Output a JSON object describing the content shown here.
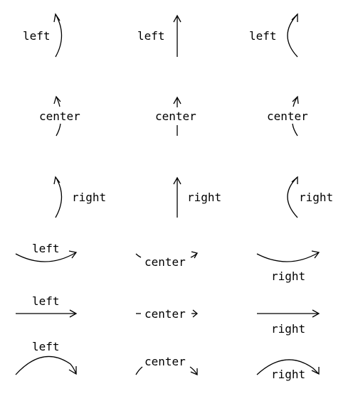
{
  "ink_color": "#000000",
  "background": "#ffffff",
  "labels": {
    "left": "left",
    "center": "center",
    "right": "right"
  },
  "examples": [
    {
      "group": "vertical",
      "label_key": "left",
      "shape": "arc-right"
    },
    {
      "group": "vertical",
      "label_key": "left",
      "shape": "straight"
    },
    {
      "group": "vertical",
      "label_key": "left",
      "shape": "arc-left"
    },
    {
      "group": "vertical",
      "label_key": "center",
      "shape": "arc-right"
    },
    {
      "group": "vertical",
      "label_key": "center",
      "shape": "straight"
    },
    {
      "group": "vertical",
      "label_key": "center",
      "shape": "arc-left"
    },
    {
      "group": "vertical",
      "label_key": "right",
      "shape": "arc-right"
    },
    {
      "group": "vertical",
      "label_key": "right",
      "shape": "straight"
    },
    {
      "group": "vertical",
      "label_key": "right",
      "shape": "arc-left"
    },
    {
      "group": "horizontal",
      "label_key": "left",
      "shape": "arc-down"
    },
    {
      "group": "horizontal",
      "label_key": "center",
      "shape": "arc-down"
    },
    {
      "group": "horizontal",
      "label_key": "right",
      "shape": "arc-down"
    },
    {
      "group": "horizontal",
      "label_key": "left",
      "shape": "straight"
    },
    {
      "group": "horizontal",
      "label_key": "center",
      "shape": "straight"
    },
    {
      "group": "horizontal",
      "label_key": "right",
      "shape": "straight"
    },
    {
      "group": "horizontal",
      "label_key": "left",
      "shape": "arc-up"
    },
    {
      "group": "horizontal",
      "label_key": "center",
      "shape": "arc-up"
    },
    {
      "group": "horizontal",
      "label_key": "right",
      "shape": "arc-up"
    }
  ]
}
